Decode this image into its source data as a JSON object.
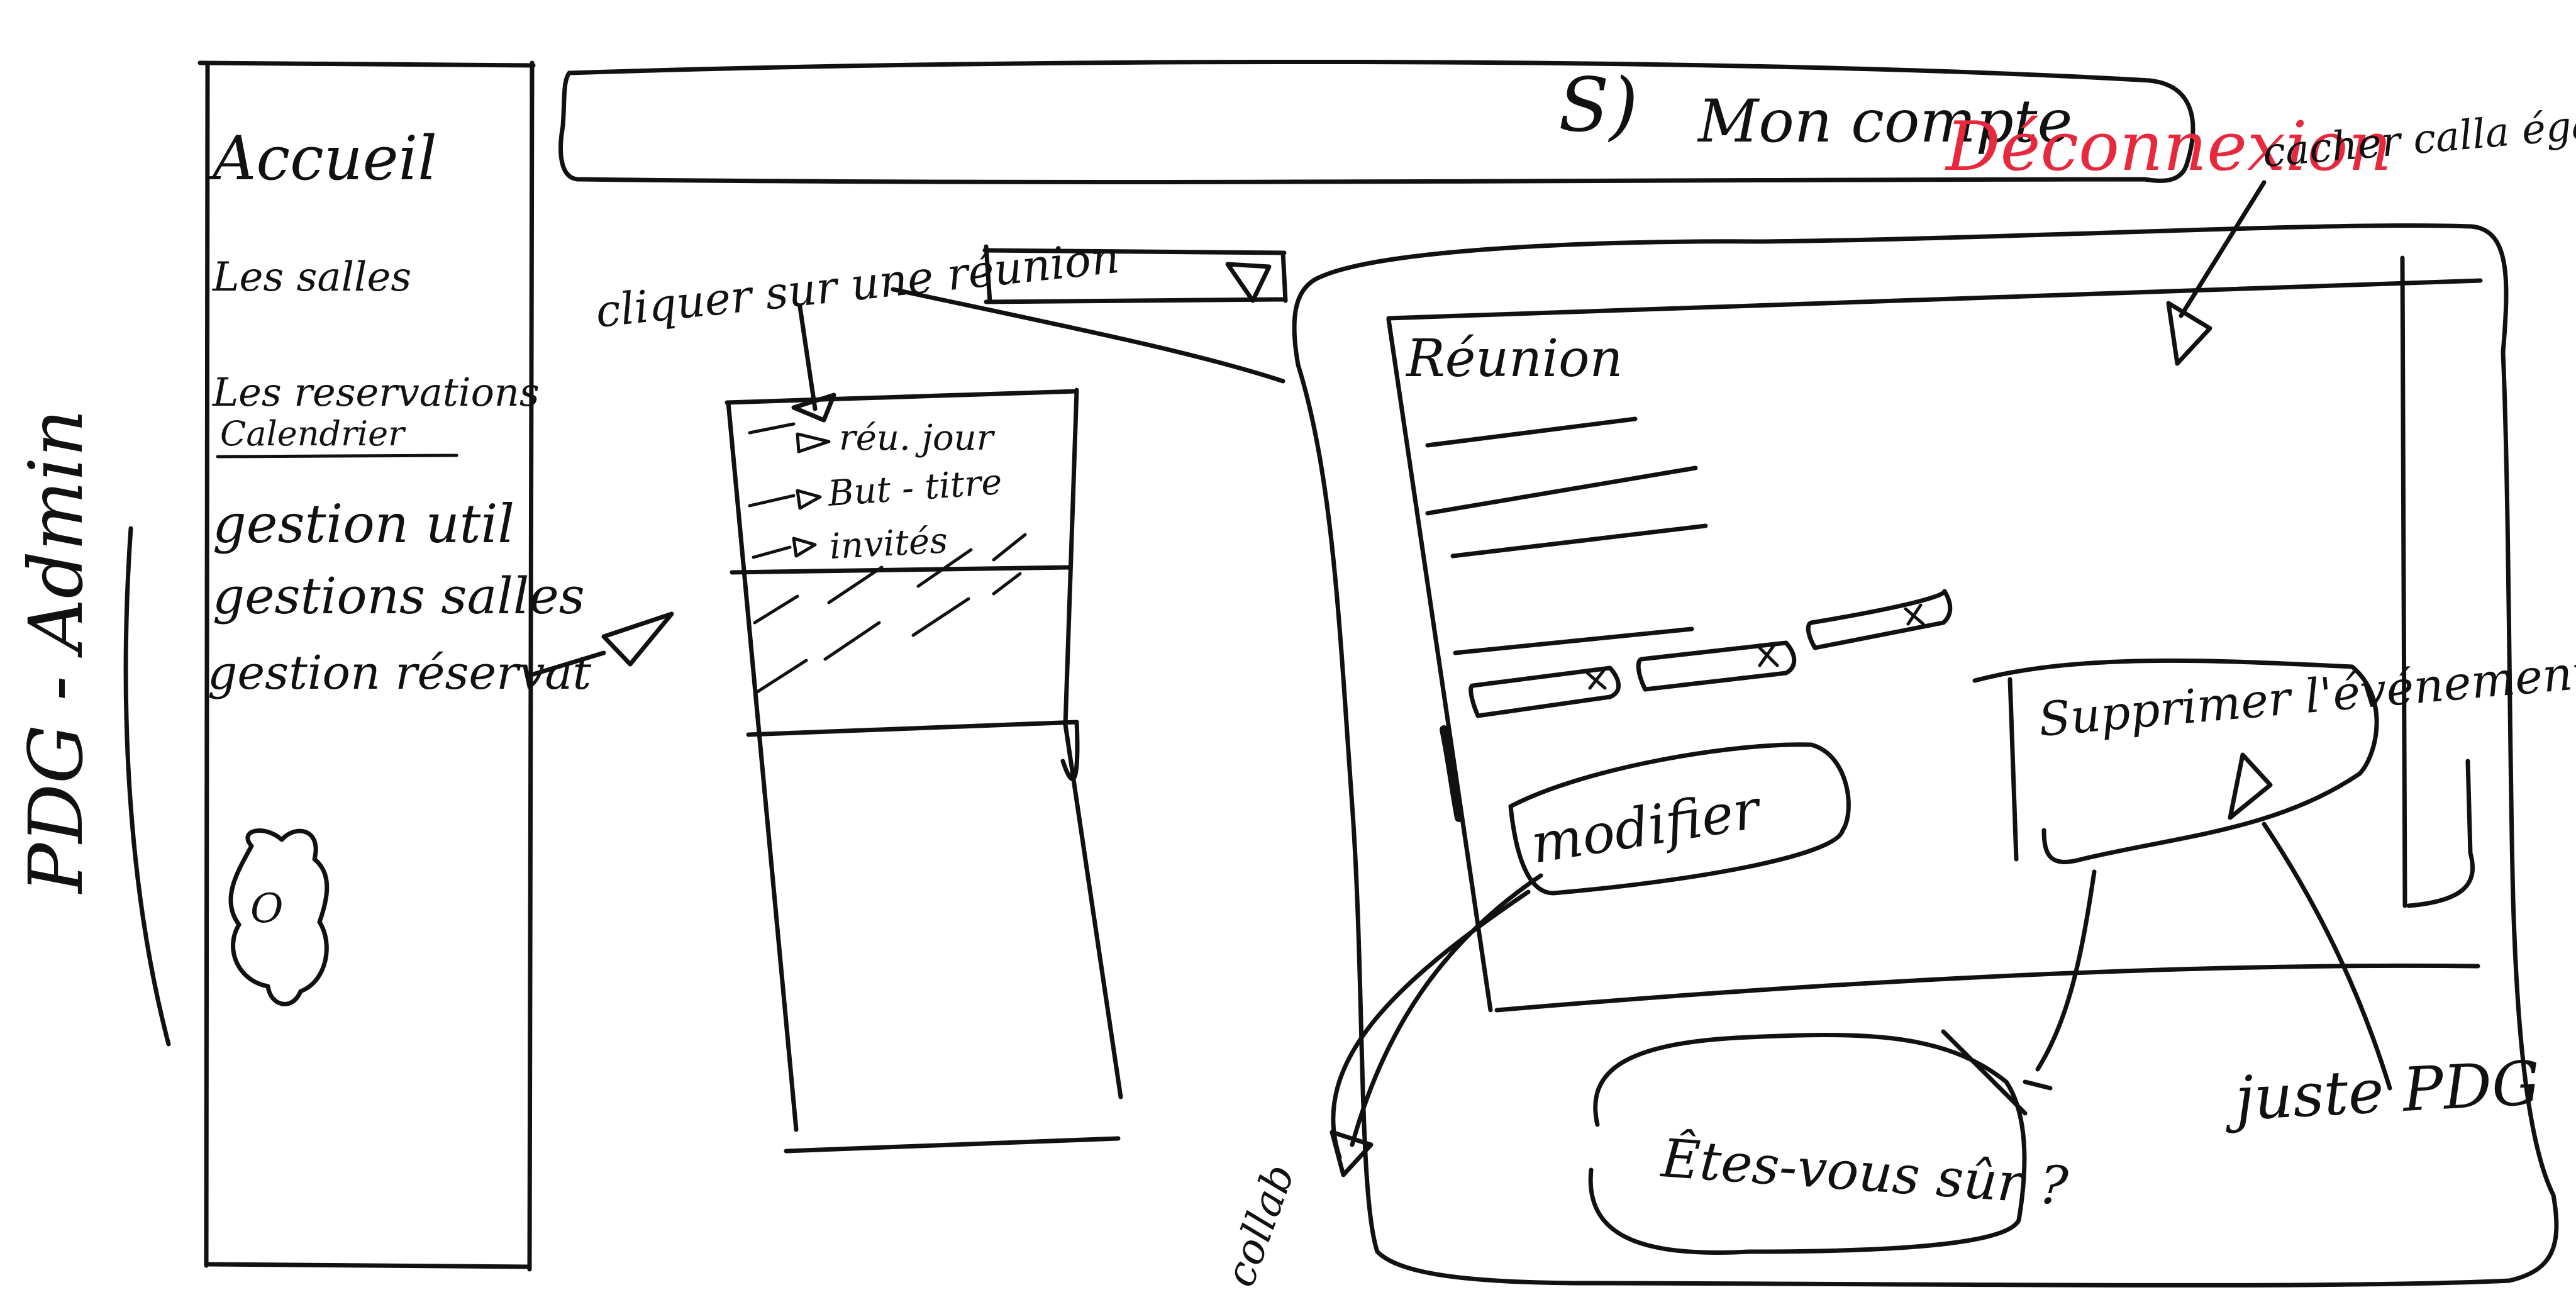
{
  "role_label": "PDG - Admin",
  "sidebar": {
    "items": [
      {
        "label": "Accueil"
      },
      {
        "label": "Les salles"
      },
      {
        "label": "Les reservations"
      },
      {
        "label": "Calendrier"
      },
      {
        "label": "gestion util"
      },
      {
        "label": "gestions salles"
      },
      {
        "label": "gestion réservat"
      }
    ],
    "avatar_symbol": "O"
  },
  "header": {
    "logo_glyph": "S)",
    "account_label": "Mon compte",
    "logout_label": "Déconnexion"
  },
  "annotations": {
    "click_meeting": "cliquer sur une réunion",
    "close_modal": "cacher calla également",
    "collab": "collab",
    "just_ceo": "juste PDG"
  },
  "filter": {
    "selected": "",
    "caret": "▽"
  },
  "list": {
    "items": [
      {
        "label": "réu. jour"
      },
      {
        "label": "But - titre"
      },
      {
        "label": "invités"
      }
    ]
  },
  "modal": {
    "title": "Réunion",
    "modify_label": "modifier",
    "delete_label": "Supprimer l'événement"
  },
  "confirm": {
    "text": "Êtes-vous sûr ?"
  },
  "colors": {
    "ink": "#111111",
    "accent": "#e8283c"
  }
}
